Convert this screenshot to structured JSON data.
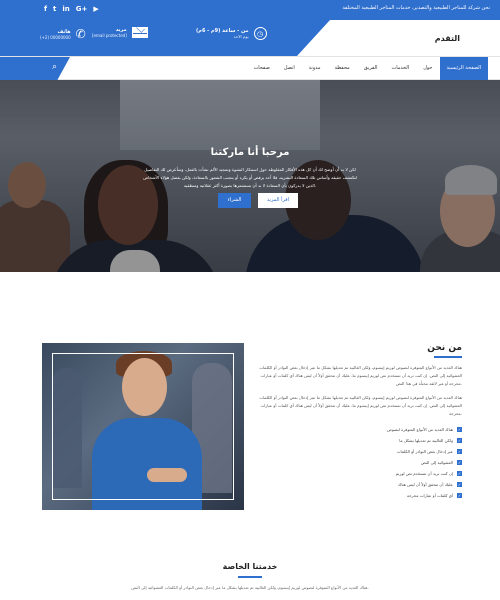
{
  "topbar": {
    "tagline": "نحن شركة للمتاجر الطبيعية والتصدير، خدمات المتاجر الطبيعية المختلفة",
    "social": [
      "f",
      "t",
      "in",
      "G+",
      "▶"
    ]
  },
  "header": {
    "logo": "التقدم",
    "hours_title": "من - ساعة (9م - 6م)",
    "hours_sub": "يوم الاحد",
    "email_title": "مريد",
    "email_sub": "[email protected]",
    "phone_title": "هاتف",
    "phone_sub": "(+2) 00000000"
  },
  "nav": {
    "items": [
      "الصفحة الرئيسية",
      "حول",
      "الخدمات",
      "الفريق",
      "محفظة",
      "مدونة",
      "اتصل",
      "صفحات"
    ]
  },
  "hero": {
    "title": "مرحبا أنا ماركتنا",
    "text": "لكن لا بد أن أوضح لك أن كل هذه الأفكار المغلوطة حول استنكار النشوة وتمجيد الألم نشأت بالفعل، وسأعرض لك التفاصيل لتكتشف حقيقة وأساس تلك السعادة البشرية، فلا أحد يرفض أو يكره أو يتجنب الشعور بالسعادة، ولكن بفضل هؤلاء الأشخاص الذين لا يدركون بأن السعادة لا بد أن نستشعرها بصورة أكثر عقلانية ومنطقية.",
    "btn_more": "اقرأ المزيد",
    "btn_buy": "الشراء"
  },
  "about": {
    "title": "من نحن",
    "p1": "هناك العديد من الأنواع المتوفرة لنصوص لوريم إيبسوم، ولكن الغالبية تم تعديلها بشكل ما عبر إدخال بعض النوادر أو الكلمات العشوائية إلى النص. إن كنت تريد أن تستخدم نص لوريم إيبسوم ما، عليك أن تتحقق أولاً أن ليس هناك أي كلمات أو عبارات محرجة أو غير لائقة مخبأة في هذا النص.",
    "p2": "هناك العديد من الأنواع المتوفرة لنصوص لوريم إيبسوم، ولكن الغالبية تم تعديلها بشكل ما عبر إدخال بعض النوادر أو الكلمات العشوائية إلى النص. إن كنت تريد أن تستخدم نص لوريم إيبسوم ما، عليك أن تتحقق أولاً أن ليس هناك أي كلمات أو عبارات محرجة.",
    "checklist": [
      "هناك العديد من الأنواع المتوفرة لنصوص",
      "ولكن الغالبية تم تعديلها بشكل ما",
      "عبر إدخال بعض النوادر أو الكلمات",
      "العشوائية إلى النص",
      "إن كنت تريد أن تستخدم نص لوريم",
      "عليك أن تتحقق أولاً أن ليس هناك",
      "أي كلمات أو عبارات محرجة"
    ]
  },
  "services": {
    "title": "خدمتنا الخاصة",
    "text": "هناك العديد من الأنواع المتوفرة لنصوص لوريم إيبسوم، ولكن الغالبية تم تعديلها بشكل ما عبر إدخال بعض النوادر أو الكلمات العشوائية إلى النص."
  },
  "colors": {
    "primary": "#2f6fce"
  }
}
